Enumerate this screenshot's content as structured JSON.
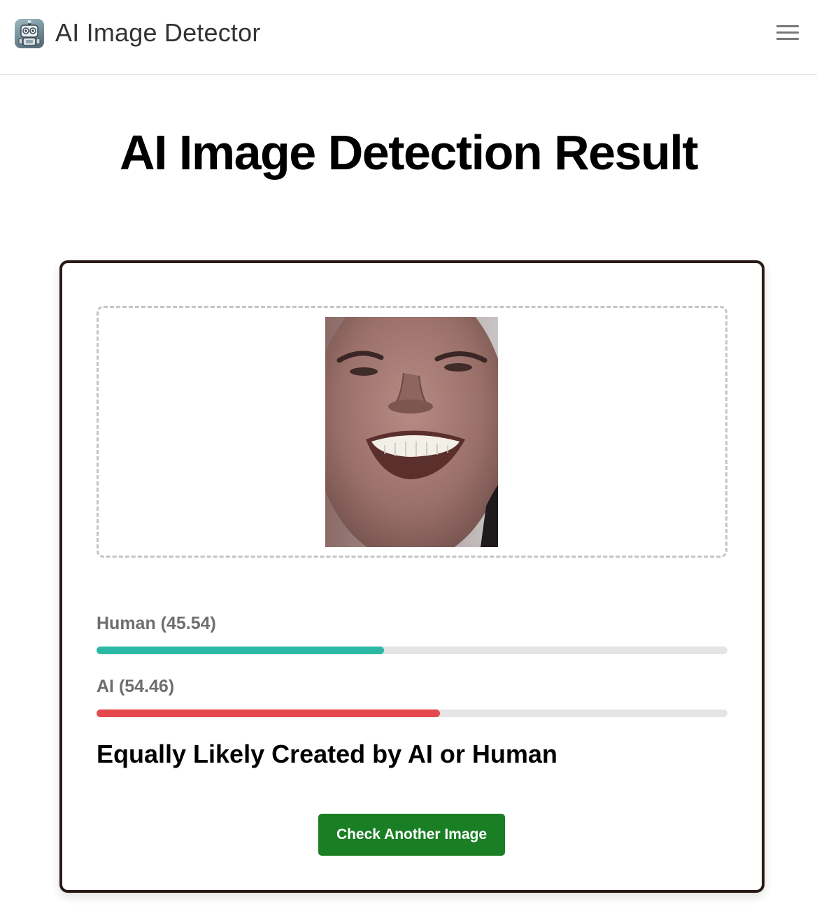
{
  "header": {
    "app_title": "AI Image Detector",
    "logo_icon": "robot-icon",
    "menu_icon": "hamburger-menu-icon"
  },
  "page": {
    "title": "AI Image Detection Result"
  },
  "result": {
    "image_description": "uploaded-photo-face",
    "human": {
      "label": "Human (45.54)",
      "percent": 45.54,
      "color": "#2bb9a6"
    },
    "ai": {
      "label": "AI (54.46)",
      "percent": 54.46,
      "color": "#e5484d"
    },
    "verdict": "Equally Likely Created by AI or Human",
    "action_label": "Check Another Image",
    "action_color": "#1a7f24"
  }
}
